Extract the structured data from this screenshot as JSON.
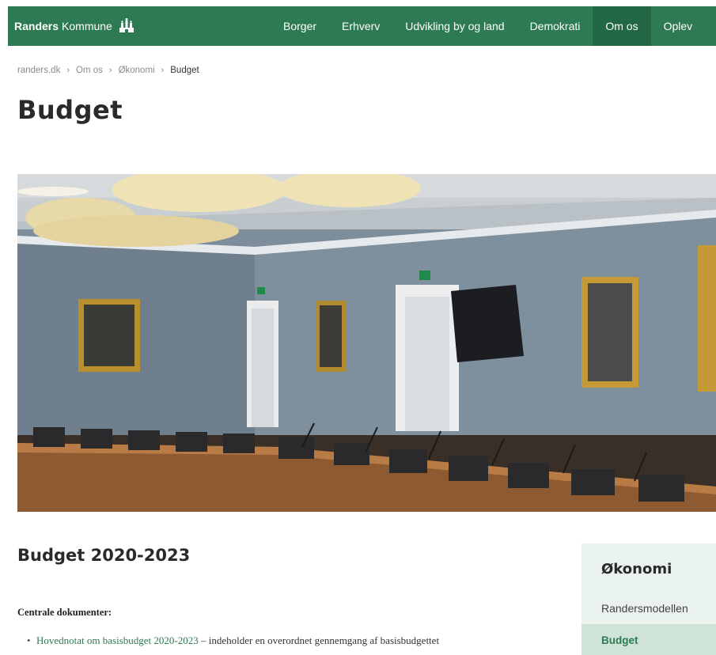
{
  "header": {
    "logo_bold": "Randers",
    "logo_light": "Kommune",
    "nav": [
      "Borger",
      "Erhverv",
      "Udvikling by og land",
      "Demokrati",
      "Om os",
      "Oplev"
    ],
    "active_nav": "Om os",
    "colors": {
      "bar": "#2d7a53",
      "active": "#236845"
    }
  },
  "breadcrumb": [
    "randers.dk",
    "Om os",
    "Økonomi",
    "Budget"
  ],
  "page_title": "Budget",
  "content": {
    "section_title": "Budget 2020-2023",
    "documents_label": "Centrale dokumenter:",
    "items": [
      {
        "link": "Hovednotat om basisbudget 2020-2023",
        "text": " – indeholder en overordnet gennemgang af basisbudgettet"
      }
    ]
  },
  "sidebar": {
    "title": "Økonomi",
    "items": [
      {
        "label": "Randersmodellen"
      },
      {
        "label": "Budget"
      }
    ]
  }
}
